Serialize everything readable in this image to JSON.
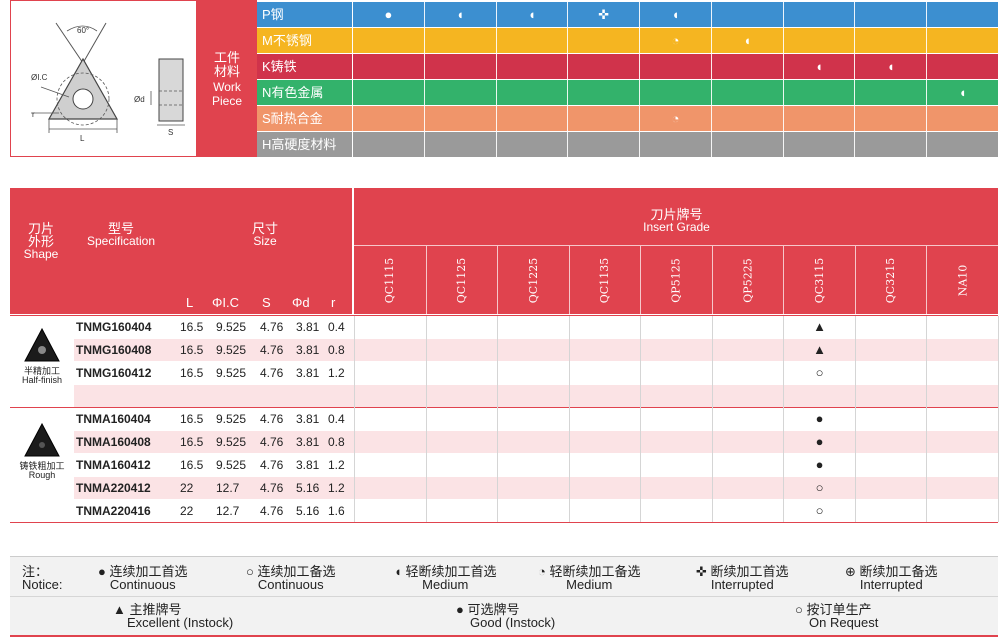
{
  "colors": {
    "red": "#e0434e",
    "blue": "#3c8fd0",
    "yellow": "#f5b521",
    "crimson": "#d0334b",
    "green": "#33b26b",
    "orange": "#f0956a",
    "gray": "#9a9a9a",
    "pink": "#fbe3e5"
  },
  "diagram": {
    "angle": "60°",
    "ic": "ØI.C",
    "d": "Ød",
    "r": "r",
    "L": "L",
    "S": "S"
  },
  "work_piece": {
    "cn1": "工件",
    "cn2": "材料",
    "en1": "Work",
    "en2": "Piece"
  },
  "materials": [
    {
      "name": "P钢",
      "color": "#3c8fd0",
      "cells": [
        "●",
        "◖",
        "◖",
        "✜",
        "◖",
        "",
        "",
        "",
        ""
      ]
    },
    {
      "name": "M不锈钢",
      "color": "#f5b521",
      "cells": [
        "",
        "",
        "",
        "",
        "◔",
        "◖",
        "",
        "",
        ""
      ]
    },
    {
      "name": "K铸铁",
      "color": "#d0334b",
      "cells": [
        "",
        "",
        "",
        "",
        "",
        "",
        "◖",
        "◖",
        ""
      ]
    },
    {
      "name": "N有色金属",
      "color": "#33b26b",
      "cells": [
        "",
        "",
        "",
        "",
        "",
        "",
        "",
        "",
        "◖"
      ]
    },
    {
      "name": "S耐热合金",
      "color": "#f0956a",
      "cells": [
        "",
        "",
        "",
        "",
        "◔",
        "",
        "",
        "",
        ""
      ]
    },
    {
      "name": "H高硬度材料",
      "color": "#9a9a9a",
      "cells": [
        "",
        "",
        "",
        "",
        "",
        "",
        "",
        "",
        ""
      ]
    }
  ],
  "header": {
    "shape_cn1": "刀片",
    "shape_cn2": "外形",
    "shape_en": "Shape",
    "spec_cn": "型号",
    "spec_en": "Specification",
    "size_cn": "尺寸",
    "size_en": "Size",
    "grade_cn": "刀片牌号",
    "grade_en": "Insert Grade",
    "dims": [
      "L",
      "ΦI.C",
      "S",
      "Φd",
      "r"
    ],
    "grades": [
      "QC1115",
      "QC1125",
      "QC1225",
      "QC1135",
      "QP5125",
      "QP5225",
      "QC3115",
      "QC3215",
      "NA10"
    ]
  },
  "groups": [
    {
      "label_cn": "半精加工",
      "label_en": "Half-finish"
    },
    {
      "label_cn": "铸铁粗加工",
      "label_en": "Rough"
    }
  ],
  "rows": [
    {
      "spec": "TNMG160404",
      "L": "16.5",
      "ic": "9.525",
      "S": "4.76",
      "d": "3.81",
      "r": "0.4",
      "marks": [
        "",
        "",
        "",
        "",
        "",
        "",
        "▲",
        "",
        ""
      ]
    },
    {
      "spec": "TNMG160408",
      "L": "16.5",
      "ic": "9.525",
      "S": "4.76",
      "d": "3.81",
      "r": "0.8",
      "marks": [
        "",
        "",
        "",
        "",
        "",
        "",
        "▲",
        "",
        ""
      ]
    },
    {
      "spec": "TNMG160412",
      "L": "16.5",
      "ic": "9.525",
      "S": "4.76",
      "d": "3.81",
      "r": "1.2",
      "marks": [
        "",
        "",
        "",
        "",
        "",
        "",
        "○",
        "",
        ""
      ]
    },
    {
      "spec": "TNMA160404",
      "L": "16.5",
      "ic": "9.525",
      "S": "4.76",
      "d": "3.81",
      "r": "0.4",
      "marks": [
        "",
        "",
        "",
        "",
        "",
        "",
        "●",
        "",
        ""
      ]
    },
    {
      "spec": "TNMA160408",
      "L": "16.5",
      "ic": "9.525",
      "S": "4.76",
      "d": "3.81",
      "r": "0.8",
      "marks": [
        "",
        "",
        "",
        "",
        "",
        "",
        "●",
        "",
        ""
      ]
    },
    {
      "spec": "TNMA160412",
      "L": "16.5",
      "ic": "9.525",
      "S": "4.76",
      "d": "3.81",
      "r": "1.2",
      "marks": [
        "",
        "",
        "",
        "",
        "",
        "",
        "●",
        "",
        ""
      ]
    },
    {
      "spec": "TNMA220412",
      "L": "22",
      "ic": "12.7",
      "S": "4.76",
      "d": "5.16",
      "r": "1.2",
      "marks": [
        "",
        "",
        "",
        "",
        "",
        "",
        "○",
        "",
        ""
      ]
    },
    {
      "spec": "TNMA220416",
      "L": "22",
      "ic": "12.7",
      "S": "4.76",
      "d": "5.16",
      "r": "1.6",
      "marks": [
        "",
        "",
        "",
        "",
        "",
        "",
        "○",
        "",
        ""
      ]
    }
  ],
  "notice": {
    "label_cn": "注：",
    "label_en": "Notice:",
    "items1": [
      {
        "sym": "●",
        "cn": "连续加工首选",
        "en": "Continuous"
      },
      {
        "sym": "○",
        "cn": "连续加工备选",
        "en": "Continuous"
      },
      {
        "sym": "◖",
        "cn": "轻断续加工首选",
        "en": "Medium"
      },
      {
        "sym": "◔",
        "cn": "轻断续加工备选",
        "en": "Medium"
      },
      {
        "sym": "✜",
        "cn": "断续加工首选",
        "en": "Interrupted"
      },
      {
        "sym": "⊕",
        "cn": "断续加工备选",
        "en": "Interrupted"
      }
    ],
    "items2": [
      {
        "sym": "▲",
        "cn": "主推牌号",
        "en": "Excellent (Instock)"
      },
      {
        "sym": "●",
        "cn": "可选牌号",
        "en": "Good (Instock)"
      },
      {
        "sym": "○",
        "cn": "按订单生产",
        "en": "On Request"
      }
    ]
  }
}
